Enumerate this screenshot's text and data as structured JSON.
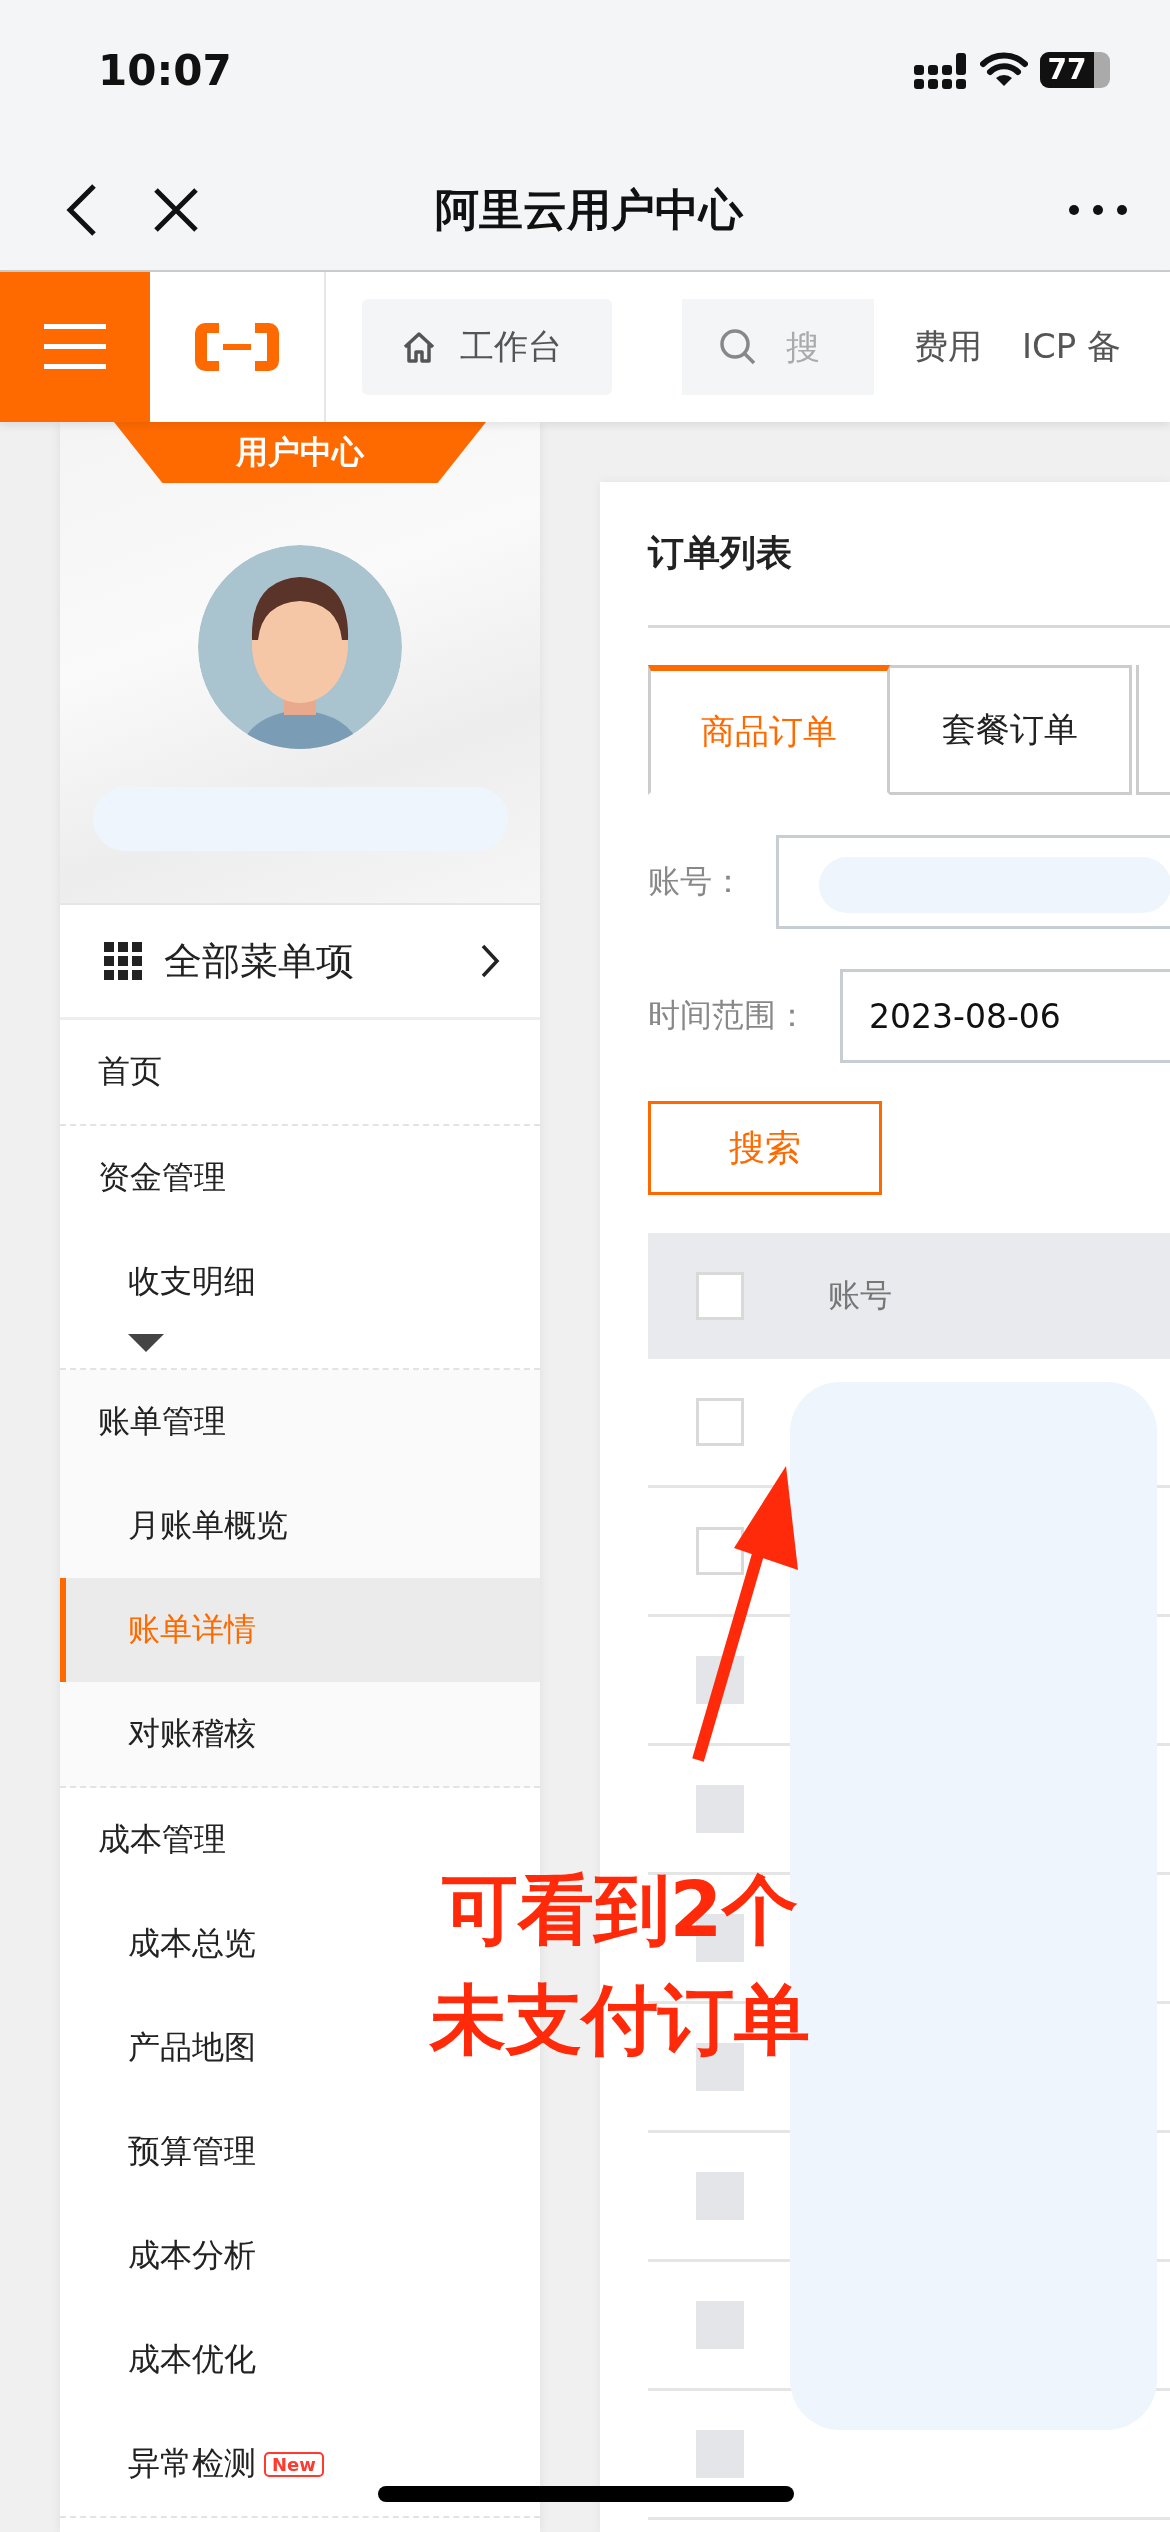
{
  "status_bar": {
    "time": "10:07",
    "battery": "77"
  },
  "nav_bar": {
    "title": "阿里云用户中心"
  },
  "toolbar": {
    "workbench": "工作台",
    "search": {
      "placeholder": "搜"
    },
    "links": [
      "费用",
      "ICP 备"
    ]
  },
  "sidebar": {
    "badge": "用户中心",
    "all_menu": "全部菜单项",
    "items": [
      {
        "label": "首页",
        "selected": false
      },
      {
        "label": "资金管理",
        "selected": false,
        "expanded": false,
        "children": [
          {
            "label": "收支明细",
            "selected": false
          }
        ]
      },
      {
        "label": "账单管理",
        "selected": false,
        "expanded": true,
        "children": [
          {
            "label": "月账单概览",
            "selected": false
          },
          {
            "label": "账单详情",
            "selected": true
          },
          {
            "label": "对账稽核",
            "selected": false
          }
        ]
      },
      {
        "label": "成本管理",
        "selected": false,
        "expanded": true,
        "children": [
          {
            "label": "成本总览",
            "selected": false
          },
          {
            "label": "产品地图",
            "selected": false
          },
          {
            "label": "预算管理",
            "selected": false
          },
          {
            "label": "成本分析",
            "selected": false
          },
          {
            "label": "成本优化",
            "selected": false
          },
          {
            "label": "异常检测",
            "selected": false,
            "badge": "New"
          }
        ]
      }
    ]
  },
  "order_panel": {
    "title": "订单列表",
    "tabs": [
      {
        "label": "商品订单",
        "selected": true
      },
      {
        "label": "套餐订单",
        "selected": false
      }
    ],
    "filters": [
      {
        "label": "账号："
      },
      {
        "label": "时间范围：",
        "value": "2023-08-06"
      }
    ],
    "search_button": "搜索",
    "table": {
      "columns": [
        "账号"
      ],
      "header_checked": false,
      "rows": [
        {
          "checked": false,
          "disabled": false
        },
        {
          "checked": false,
          "disabled": false
        },
        {
          "checked": false,
          "disabled": true
        },
        {
          "checked": false,
          "disabled": true
        },
        {
          "checked": false,
          "disabled": true
        },
        {
          "checked": false,
          "disabled": true
        },
        {
          "checked": false,
          "disabled": true
        },
        {
          "checked": false,
          "disabled": true
        },
        {
          "checked": false,
          "disabled": true
        }
      ]
    }
  },
  "annotation": {
    "lines": [
      "可看到2个",
      "未支付订单"
    ]
  }
}
